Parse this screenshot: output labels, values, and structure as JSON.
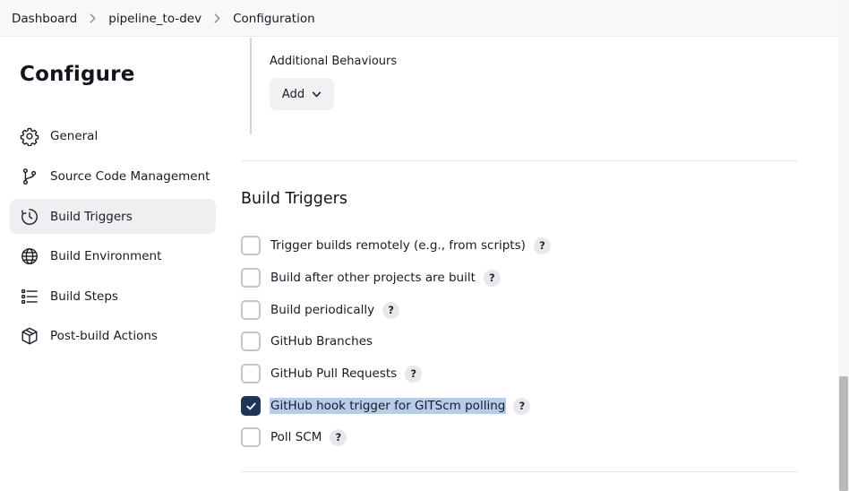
{
  "breadcrumb": {
    "items": [
      "Dashboard",
      "pipeline_to-dev",
      "Configuration"
    ]
  },
  "sidebar": {
    "title": "Configure",
    "items": [
      {
        "label": "General",
        "icon": "gear-icon"
      },
      {
        "label": "Source Code Management",
        "icon": "branch-icon"
      },
      {
        "label": "Build Triggers",
        "icon": "clock-icon",
        "active": true
      },
      {
        "label": "Build Environment",
        "icon": "globe-icon"
      },
      {
        "label": "Build Steps",
        "icon": "list-icon"
      },
      {
        "label": "Post-build Actions",
        "icon": "package-icon"
      }
    ]
  },
  "scm": {
    "additional_behaviours_label": "Additional Behaviours",
    "add_button_label": "Add"
  },
  "build_triggers": {
    "title": "Build Triggers",
    "help_symbol": "?",
    "items": [
      {
        "label": "Trigger builds remotely (e.g., from scripts)",
        "checked": false,
        "help": true
      },
      {
        "label": "Build after other projects are built",
        "checked": false,
        "help": true
      },
      {
        "label": "Build periodically",
        "checked": false,
        "help": true
      },
      {
        "label": "GitHub Branches",
        "checked": false,
        "help": false
      },
      {
        "label": "GitHub Pull Requests",
        "checked": false,
        "help": true
      },
      {
        "label": "GitHub hook trigger for GITScm polling",
        "checked": true,
        "help": true,
        "selected": true
      },
      {
        "label": "Poll SCM",
        "checked": false,
        "help": true
      }
    ]
  },
  "colors": {
    "checked_fill": "#1e3557",
    "selection_highlight": "#b6cdea",
    "active_nav_bg": "#efeff2"
  }
}
